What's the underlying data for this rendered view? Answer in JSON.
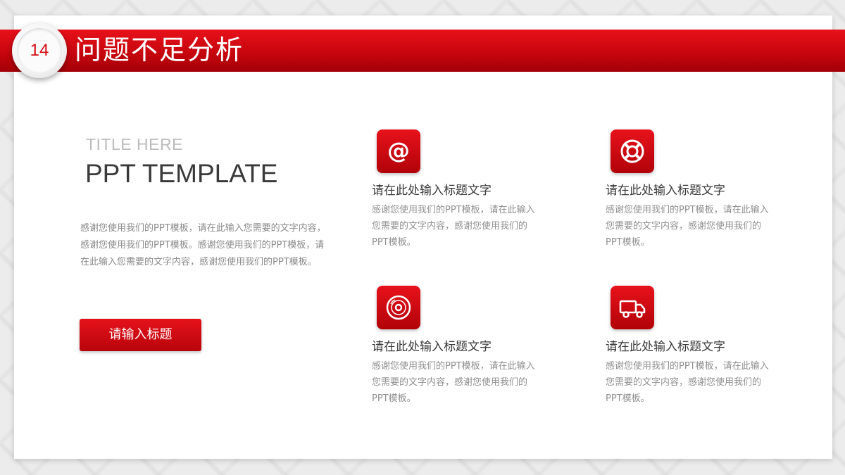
{
  "header": {
    "slide_number": "14",
    "title": "问题不足分析"
  },
  "intro": {
    "subtitle": "TITLE HERE",
    "title": "PPT TEMPLATE",
    "body": "感谢您使用我们的PPT模板，请在此输入您需要的文字内容，感谢您使用我们的PPT模板。感谢您使用我们的PPT模板，请在此输入您需要的文字内容，感谢您使用我们的PPT模板。",
    "button_label": "请输入标题"
  },
  "features": [
    {
      "icon": "at-sign-icon",
      "title": "请在此处输入标题文字",
      "desc": "感谢您使用我们的PPT模板，请在此输入您需要的文字内容，感谢您使用我们的PPT模板。"
    },
    {
      "icon": "lifebuoy-icon",
      "title": "请在此处输入标题文字",
      "desc": "感谢您使用我们的PPT模板，请在此输入您需要的文字内容，感谢您使用我们的PPT模板。"
    },
    {
      "icon": "disc-icon",
      "title": "请在此处输入标题文字",
      "desc": "感谢您使用我们的PPT模板，请在此输入您需要的文字内容，感谢您使用我们的PPT模板。"
    },
    {
      "icon": "truck-icon",
      "title": "请在此处输入标题文字",
      "desc": "感谢您使用我们的PPT模板，请在此输入您需要的文字内容，感谢您使用我们的PPT模板。"
    }
  ],
  "colors": {
    "accent": "#d40a12",
    "text_dark": "#3a3a3a",
    "text_muted": "#8f8f8f"
  }
}
